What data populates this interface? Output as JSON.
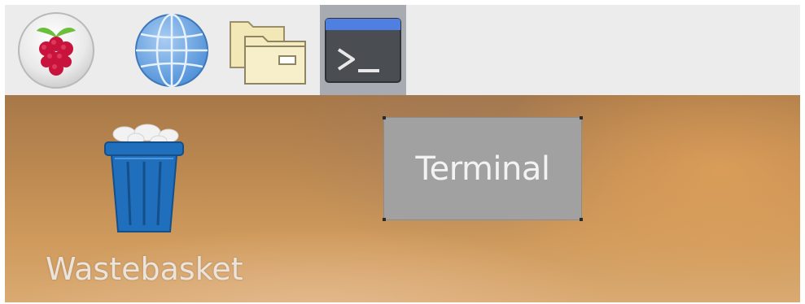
{
  "taskbar": {
    "launchers": [
      {
        "icon": "raspberry-menu-icon",
        "active": false
      },
      {
        "icon": "web-browser-globe-icon",
        "active": false
      },
      {
        "icon": "file-manager-folders-icon",
        "active": false
      },
      {
        "icon": "terminal-icon",
        "active": true,
        "prompt_glyph": ">_"
      }
    ]
  },
  "desktop": {
    "wastebasket_label": "Wastebasket"
  },
  "tooltip": {
    "text": "Terminal"
  },
  "colors": {
    "taskbar_bg": "#ececec",
    "active_button_bg": "#a8acb2",
    "tooltip_bg": "#a1a1a1",
    "bin_blue": "#1f6fbd",
    "terminal_title_blue": "#4f7fe0"
  }
}
